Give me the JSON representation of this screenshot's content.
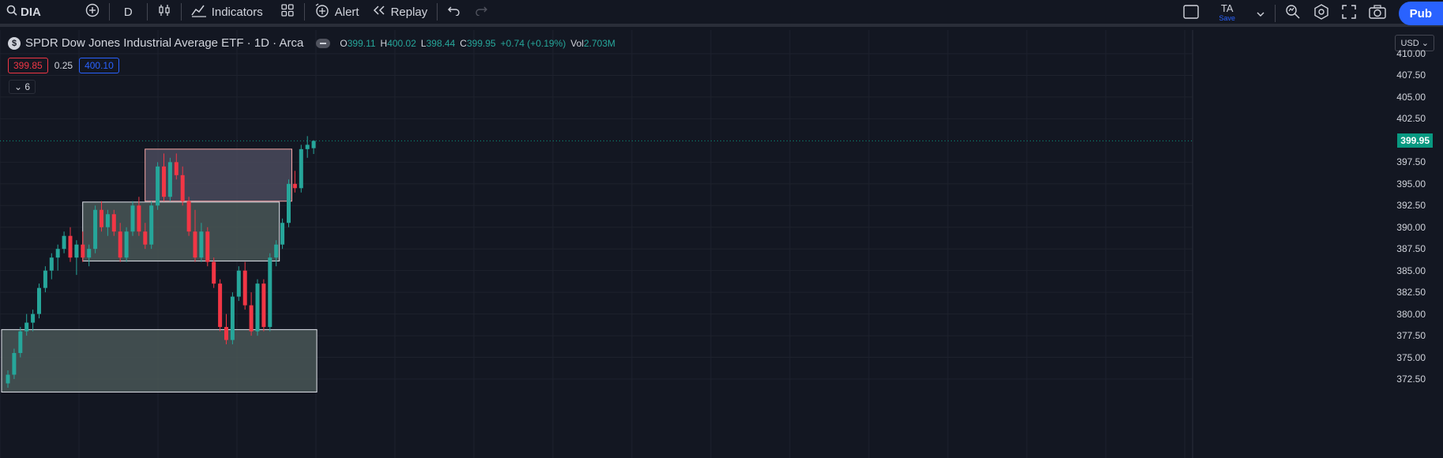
{
  "toolbar": {
    "symbol": "DIA",
    "interval": "D",
    "indicators_label": "Indicators",
    "alert_label": "Alert",
    "replay_label": "Replay",
    "layout_name": "TA",
    "layout_save": "Save",
    "publish_label": "Pub"
  },
  "legend": {
    "logo_letter": "$",
    "title": "SPDR Dow Jones Industrial Average ETF · 1D · Arca",
    "o_key": "O",
    "o_val": "399.11",
    "h_key": "H",
    "h_val": "400.02",
    "l_key": "L",
    "l_val": "398.44",
    "c_key": "C",
    "c_val": "399.95",
    "change": "+0.74 (+0.19%)",
    "vol_key": "Vol",
    "vol_val": "2.703M"
  },
  "quote": {
    "bid": "399.85",
    "spread": "0.25",
    "ask": "400.10"
  },
  "collapse_count": "6",
  "currency": "USD",
  "price_axis": [
    "410.00",
    "407.50",
    "405.00",
    "402.50",
    "397.50",
    "395.00",
    "392.50",
    "390.00",
    "387.50",
    "385.00",
    "382.50",
    "380.00",
    "377.50",
    "375.00",
    "372.50"
  ],
  "last_price": "399.95",
  "colors": {
    "up": "#26a69a",
    "down": "#f23645",
    "accent": "#2962ff",
    "bg": "#131722"
  },
  "chart_data": {
    "type": "candlestick",
    "y_range": [
      371.5,
      411.5
    ],
    "last_price": 399.95,
    "zones": [
      {
        "low": 371.0,
        "high": 378.2,
        "color": "#495656",
        "start_index": 0,
        "end_index": 49
      },
      {
        "low": 386.1,
        "high": 392.9,
        "color": "#495656",
        "start_index": 13,
        "end_index": 43
      },
      {
        "low": 393.0,
        "high": 399.0,
        "color": "#4a4a5c",
        "start_index": 23,
        "end_index": 45
      }
    ],
    "candles": [
      [
        372.0,
        373.5,
        371.5,
        373.0
      ],
      [
        373.0,
        376.0,
        372.5,
        375.5
      ],
      [
        375.5,
        378.5,
        375.0,
        378.0
      ],
      [
        378.0,
        380.0,
        377.5,
        379.0
      ],
      [
        379.0,
        380.5,
        378.0,
        380.0
      ],
      [
        380.0,
        383.5,
        379.5,
        383.0
      ],
      [
        383.0,
        385.5,
        382.5,
        385.0
      ],
      [
        385.0,
        387.0,
        384.0,
        386.5
      ],
      [
        386.5,
        388.0,
        385.0,
        387.5
      ],
      [
        387.5,
        389.5,
        387.0,
        389.0
      ],
      [
        389.0,
        390.0,
        386.0,
        386.5
      ],
      [
        386.5,
        388.5,
        384.5,
        388.0
      ],
      [
        388.0,
        389.5,
        386.0,
        386.5
      ],
      [
        386.5,
        388.0,
        385.5,
        387.5
      ],
      [
        387.5,
        392.5,
        387.0,
        392.0
      ],
      [
        392.0,
        393.0,
        389.5,
        390.0
      ],
      [
        390.0,
        392.0,
        389.0,
        391.5
      ],
      [
        391.5,
        392.0,
        389.0,
        389.5
      ],
      [
        389.5,
        390.5,
        386.0,
        386.5
      ],
      [
        386.5,
        390.0,
        386.0,
        389.5
      ],
      [
        389.5,
        393.0,
        389.0,
        392.5
      ],
      [
        392.5,
        393.5,
        389.0,
        389.5
      ],
      [
        389.5,
        390.5,
        387.5,
        388.0
      ],
      [
        388.0,
        393.0,
        387.5,
        392.5
      ],
      [
        392.5,
        397.5,
        392.0,
        397.0
      ],
      [
        397.0,
        398.5,
        393.0,
        393.5
      ],
      [
        393.5,
        398.0,
        393.0,
        397.5
      ],
      [
        397.5,
        398.5,
        395.5,
        396.0
      ],
      [
        396.0,
        397.0,
        392.5,
        393.0
      ],
      [
        393.0,
        393.5,
        389.0,
        389.5
      ],
      [
        389.5,
        392.0,
        386.0,
        386.5
      ],
      [
        386.5,
        390.5,
        386.0,
        389.5
      ],
      [
        389.5,
        390.0,
        385.5,
        386.0
      ],
      [
        386.0,
        386.5,
        383.0,
        383.5
      ],
      [
        383.5,
        384.0,
        378.0,
        378.5
      ],
      [
        378.5,
        380.0,
        376.5,
        377.0
      ],
      [
        377.0,
        382.5,
        376.5,
        382.0
      ],
      [
        382.0,
        385.5,
        381.5,
        385.0
      ],
      [
        385.0,
        386.0,
        380.5,
        381.0
      ],
      [
        381.0,
        382.5,
        377.5,
        378.0
      ],
      [
        378.0,
        384.0,
        377.5,
        383.5
      ],
      [
        383.5,
        384.0,
        378.0,
        378.5
      ],
      [
        378.5,
        387.0,
        378.0,
        386.5
      ],
      [
        386.5,
        388.5,
        385.5,
        388.0
      ],
      [
        388.0,
        391.0,
        387.5,
        390.5
      ],
      [
        390.5,
        395.5,
        390.0,
        395.0
      ],
      [
        395.0,
        396.5,
        394.0,
        394.5
      ],
      [
        394.5,
        399.5,
        394.0,
        399.0
      ],
      [
        399.0,
        400.5,
        398.0,
        399.5
      ],
      [
        399.11,
        400.02,
        398.44,
        399.95
      ]
    ]
  }
}
